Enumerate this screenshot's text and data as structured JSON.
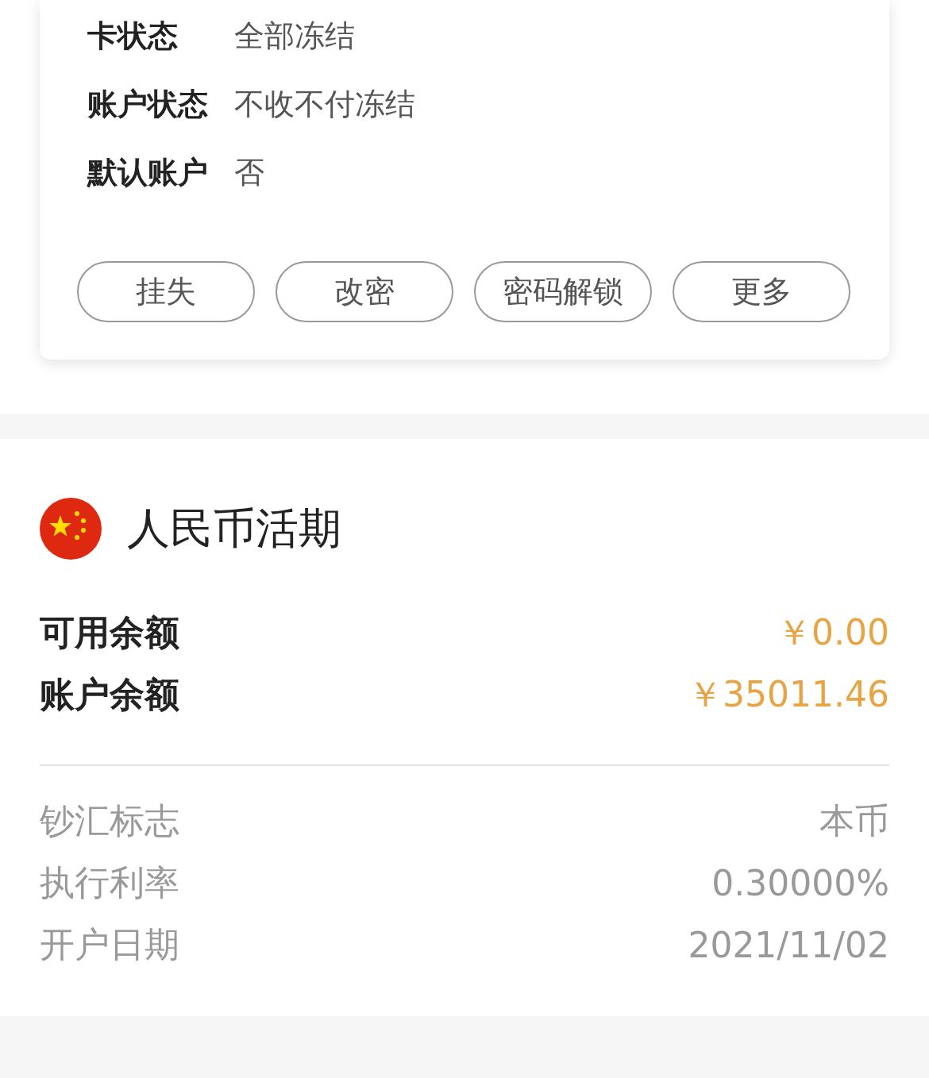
{
  "card_info": [
    {
      "label": "卡状态",
      "value": "全部冻结"
    },
    {
      "label": "账户状态",
      "value": "不收不付冻结"
    },
    {
      "label": "默认账户",
      "value": "否"
    }
  ],
  "actions": [
    "挂失",
    "改密",
    "密码解锁",
    "更多"
  ],
  "account": {
    "title": "人民币活期",
    "balances": [
      {
        "label": "可用余额",
        "value": "￥0.00"
      },
      {
        "label": "账户余额",
        "value": "￥35011.46"
      }
    ],
    "details": [
      {
        "label": "钞汇标志",
        "value": "本币"
      },
      {
        "label": "执行利率",
        "value": "0.30000%"
      },
      {
        "label": "开户日期",
        "value": "2021/11/02"
      }
    ]
  }
}
